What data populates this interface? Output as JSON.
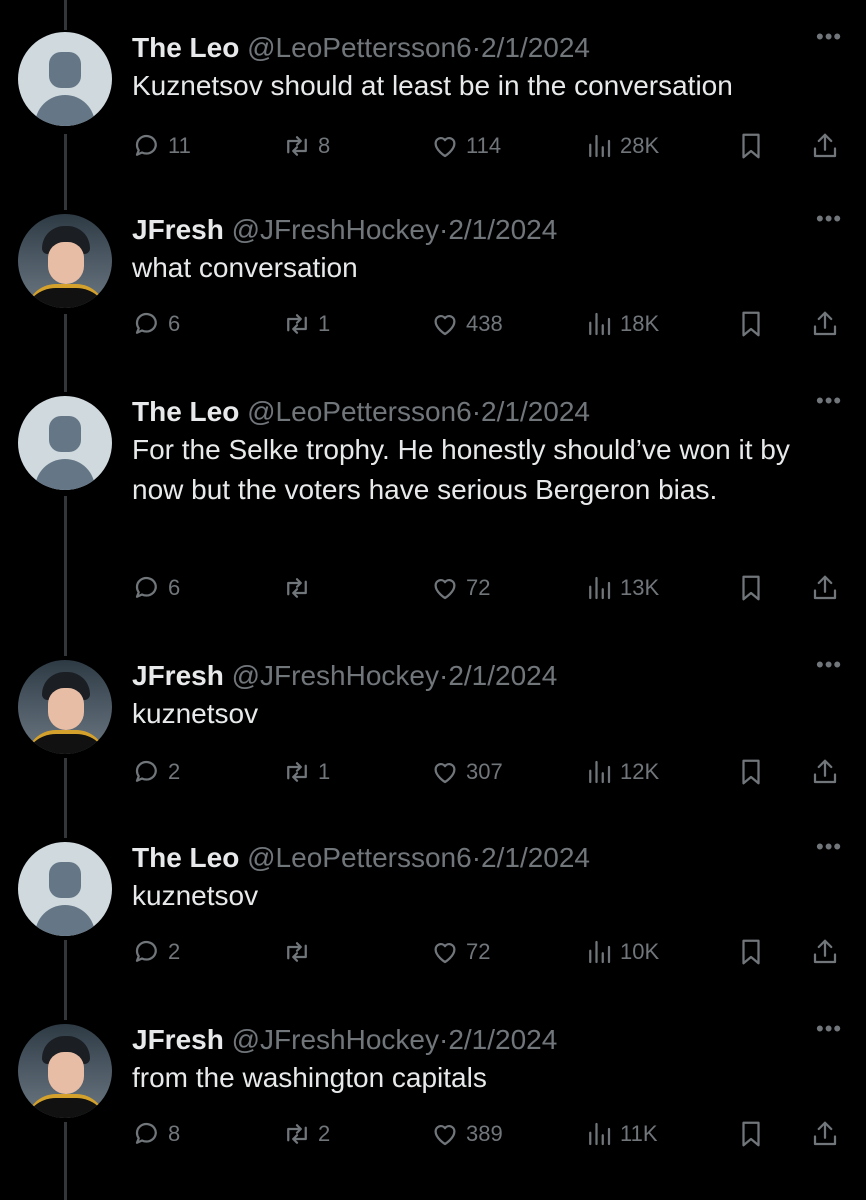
{
  "tweets": [
    {
      "name": "The Leo",
      "handle": "@LeoPettersson6",
      "sep": "·",
      "date": "2/1/2024",
      "text": "Kuznetsov should at least be in the conversation",
      "replies": "11",
      "retweets": "8",
      "likes": "114",
      "views": "28K",
      "avatar": "default-avatar"
    },
    {
      "name": "JFresh",
      "handle": "@JFreshHockey",
      "sep": "·",
      "date": "2/1/2024",
      "text": "what conversation",
      "replies": "6",
      "retweets": "1",
      "likes": "438",
      "views": "18K",
      "avatar": "hockey-player-photo"
    },
    {
      "name": "The Leo",
      "handle": "@LeoPettersson6",
      "sep": "·",
      "date": "2/1/2024",
      "text": "For the Selke trophy. He honestly should’ve won it by now but the voters have serious Bergeron bias.",
      "replies": "6",
      "retweets": "",
      "likes": "72",
      "views": "13K",
      "avatar": "default-avatar"
    },
    {
      "name": "JFresh",
      "handle": "@JFreshHockey",
      "sep": "·",
      "date": "2/1/2024",
      "text": "kuznetsov",
      "replies": "2",
      "retweets": "1",
      "likes": "307",
      "views": "12K",
      "avatar": "hockey-player-photo"
    },
    {
      "name": "The Leo",
      "handle": "@LeoPettersson6",
      "sep": "·",
      "date": "2/1/2024",
      "text": "kuznetsov",
      "replies": "2",
      "retweets": "",
      "likes": "72",
      "views": "10K",
      "avatar": "default-avatar"
    },
    {
      "name": "JFresh",
      "handle": "@JFreshHockey",
      "sep": "·",
      "date": "2/1/2024",
      "text": "from the washington capitals",
      "replies": "8",
      "retweets": "2",
      "likes": "389",
      "views": "11K",
      "avatar": "hockey-player-photo"
    }
  ],
  "icons": {
    "reply": "reply-icon",
    "retweet": "retweet-icon",
    "like": "heart-icon",
    "views": "views-chart-icon",
    "bookmark": "bookmark-icon",
    "share": "share-icon",
    "more": "more-options-icon"
  },
  "colors": {
    "background": "#000000",
    "text_primary": "#e7e9ea",
    "text_secondary": "#71767b",
    "thread_line": "#333639"
  }
}
